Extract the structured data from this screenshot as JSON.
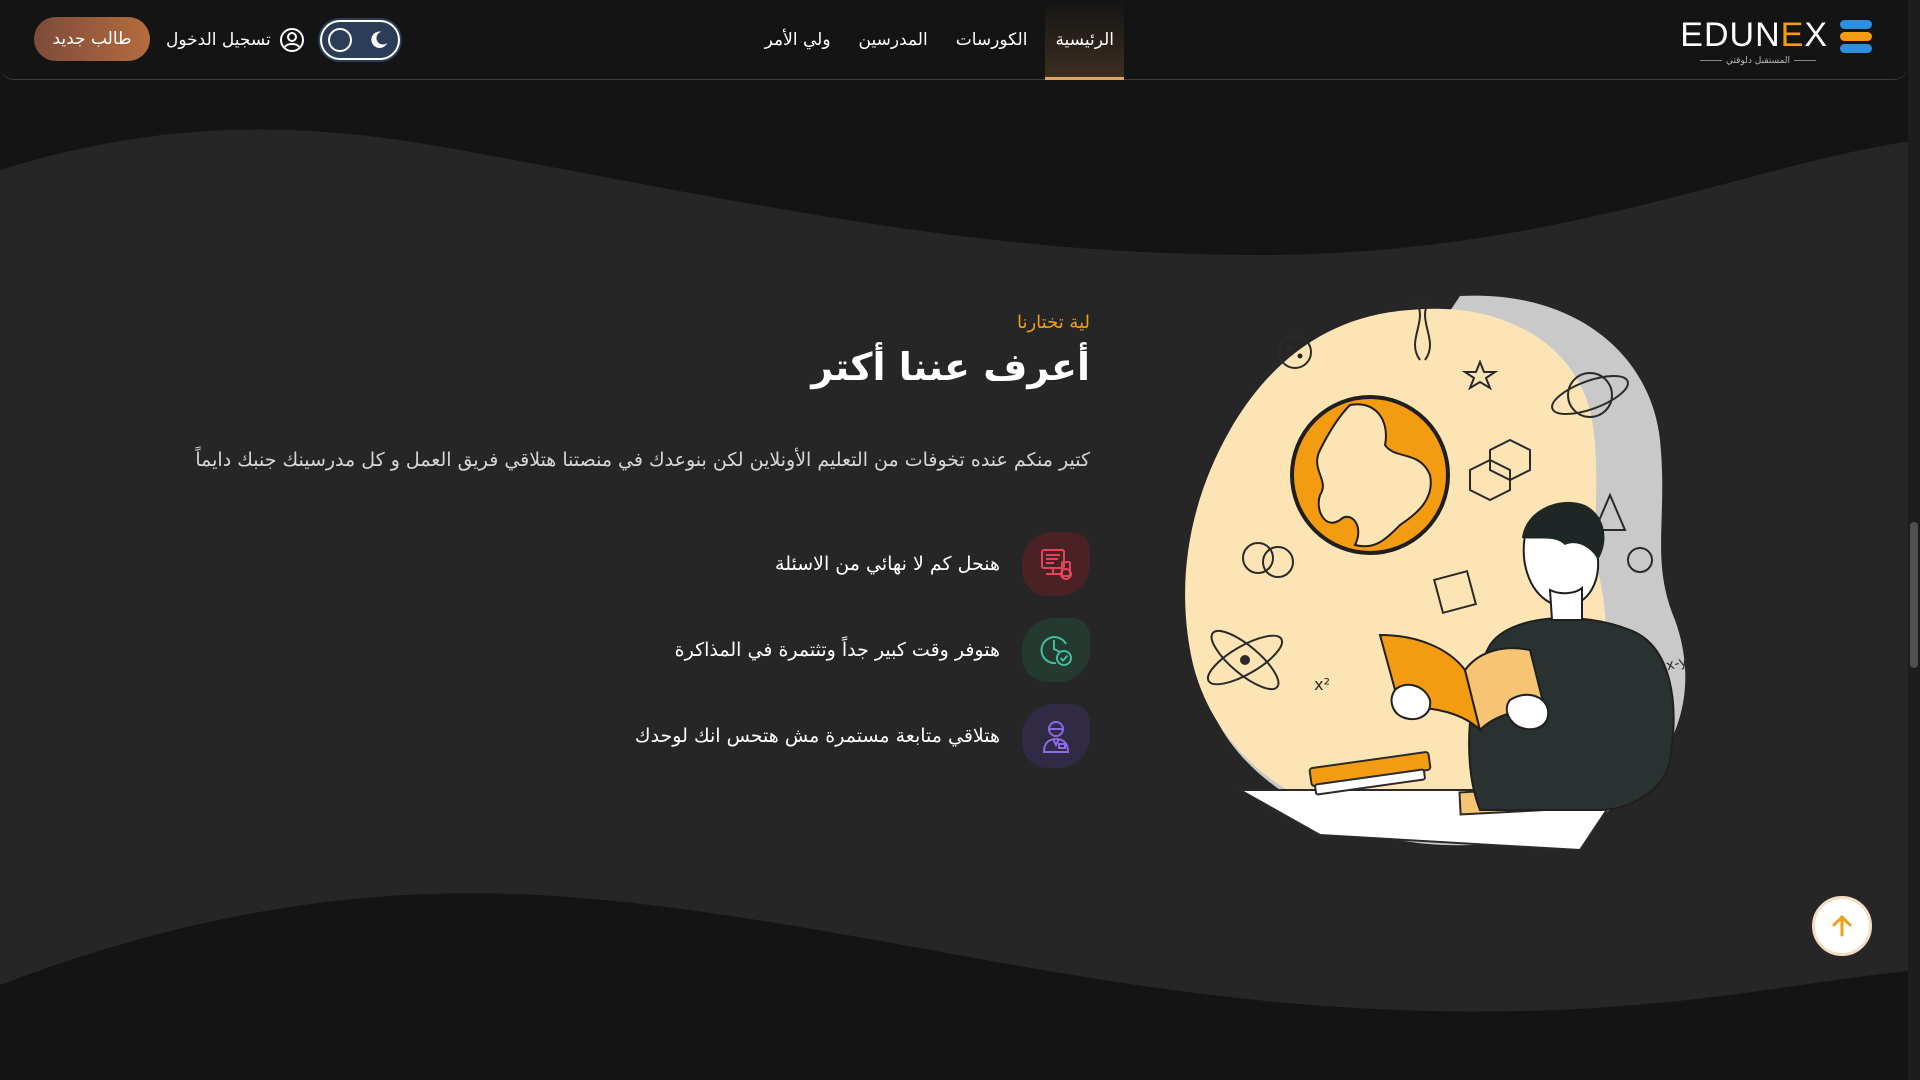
{
  "brand": {
    "logo_text_pre": "EDUN",
    "logo_text_x": "E",
    "logo_text_post": "X",
    "tagline": "المستقبل دلوقتي",
    "accent_color": "#f39c12"
  },
  "nav": {
    "items": [
      {
        "label": "الرئيسية",
        "active": true
      },
      {
        "label": "الكورسات",
        "active": false
      },
      {
        "label": "المدرسين",
        "active": false
      },
      {
        "label": "ولي الأمر",
        "active": false
      }
    ]
  },
  "header": {
    "theme_toggle_icon": "moon-icon",
    "login_label": "تسجيل الدخول",
    "login_icon": "user-circle-icon",
    "register_label": "طالب جديد"
  },
  "about": {
    "eyebrow": "لية تختارنا",
    "title": "أعرف عننا أكتر",
    "description": "كتير منكم عنده تخوفات من التعليم الأونلاين لكن بنوعدك في منصتنا هتلاقي فريق العمل و كل مدرسينك جنبك دايماً",
    "features": [
      {
        "text": "هنحل كم لا نهائي من الاسئلة",
        "icon": "computer-question-icon",
        "color": "#e0455a",
        "bg": "#4a2124"
      },
      {
        "text": "هتوفر وقت كبير جداً وتثتمرة في المذاكرة",
        "icon": "clock-check-icon",
        "color": "#3fbf9f",
        "bg": "#24392f"
      },
      {
        "text": "هتلاقي متابعة مستمرة مش هتحس انك لوحدك",
        "icon": "teacher-icon",
        "color": "#8d6be8",
        "bg": "#302a45"
      }
    ]
  },
  "back_to_top_icon": "arrow-up-icon"
}
